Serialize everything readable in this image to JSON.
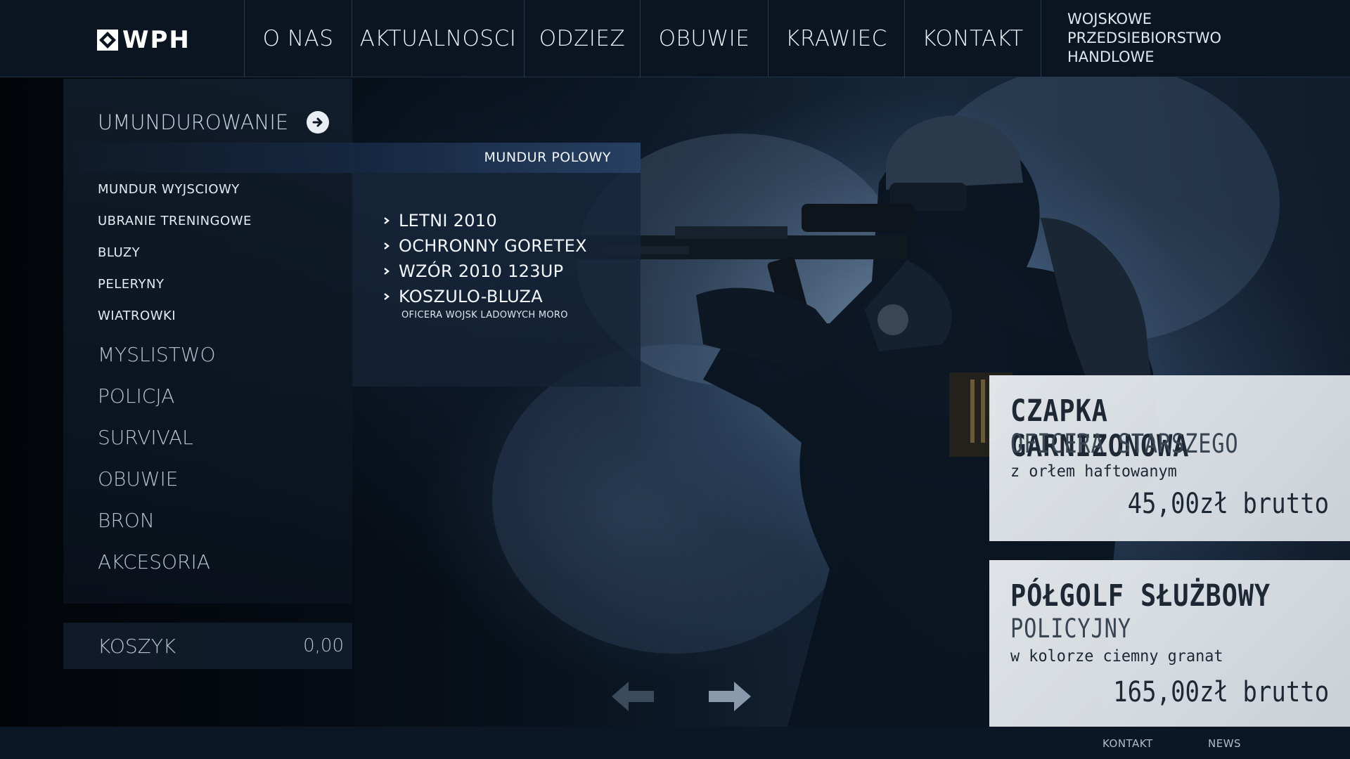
{
  "header": {
    "logo_text": "WPH",
    "nav": [
      "O NAS",
      "AKTUALNOSCI",
      "ODZIEZ",
      "OBUWIE",
      "KRAWIEC",
      "KONTAKT"
    ],
    "tagline": [
      "WOJSKOWE",
      "PRZEDSIEBIORSTWO",
      "HANDLOWE"
    ]
  },
  "sidebar": {
    "active_category": "UMUNDUROWANIE",
    "active_subcategory": "MUNDUR POLOWY",
    "subcategories": [
      "MUNDUR WYJSCIOWY",
      "UBRANIE TRENINGOWE",
      "BLUZY",
      "PELERYNY",
      "WIATROWKI"
    ],
    "categories": [
      "MYSLISTWO",
      "POLICJA",
      "SURVIVAL",
      "OBUWIE",
      "BRON",
      "AKCESORIA"
    ]
  },
  "flyout": {
    "items": [
      "LETNI 2010",
      "OCHRONNY GORETEX",
      "WZÓR 2010 123UP",
      "KOSZULO-BLUZA"
    ],
    "last_item_sub": "OFICERA WOJSK LADOWYCH MORO"
  },
  "cart": {
    "label": "KOSZYK",
    "value": "0,00"
  },
  "products": [
    {
      "title": "CZAPKA GARNIZONOWA",
      "subtitle": "OFICERA STARSZEGO",
      "description": "z orłem haftowanym",
      "price": "45,00zł brutto"
    },
    {
      "title": "PÓŁGOLF SŁUŻBOWY",
      "subtitle": "POLICYJNY",
      "description": "w kolorze ciemny granat",
      "price": "165,00zł brutto"
    }
  ],
  "footer": {
    "links": [
      "KONTAKT",
      "NEWS"
    ]
  },
  "icons": {
    "logo": "logo-mark-icon",
    "menu_arrow": "arrow-right-circle-icon",
    "slider_prev": "arrow-left-icon",
    "slider_next": "arrow-right-icon",
    "bullet": "chevron-right-icon"
  },
  "colors": {
    "header_bg": "#0a1521",
    "panel_bg": "#121e2c",
    "card_bg": "#e2e6ea",
    "footer_bg": "#0b1724"
  }
}
